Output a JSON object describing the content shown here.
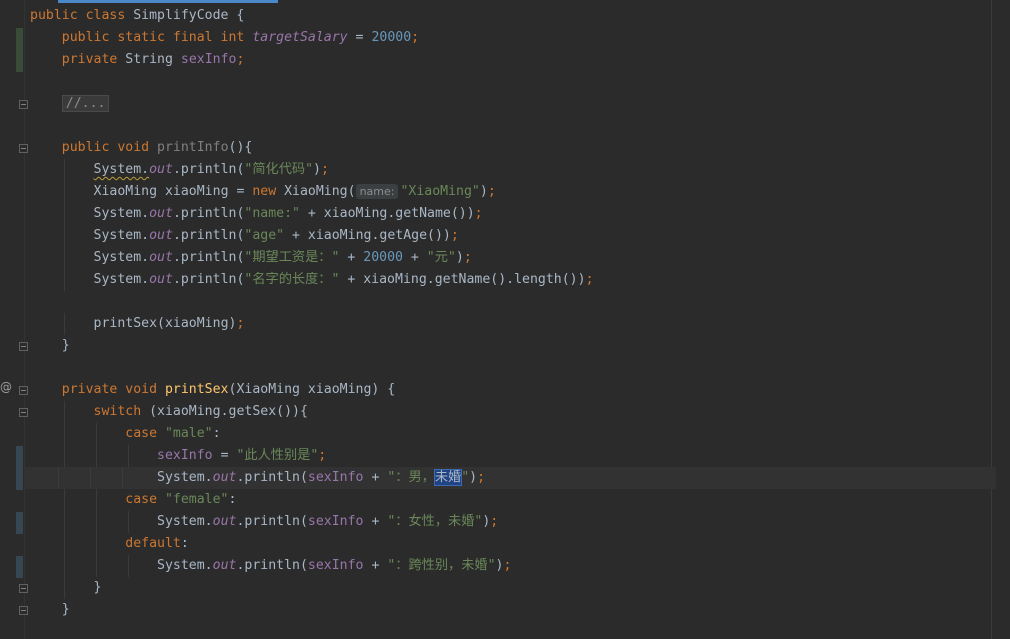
{
  "editor": {
    "lines": [
      [
        [
          "kw",
          "public class "
        ],
        [
          "plain",
          "SimplifyCode {"
        ]
      ],
      [
        [
          "kw",
          "public static final int "
        ],
        [
          "fld-i",
          "targetSalary"
        ],
        [
          "plain",
          " = "
        ],
        [
          "num",
          "20000"
        ],
        [
          "kw",
          ";"
        ]
      ],
      [
        [
          "kw",
          "private "
        ],
        [
          "plain",
          "String "
        ],
        [
          "fld",
          "sexInfo"
        ],
        [
          "kw",
          ";"
        ]
      ],
      [],
      [
        [
          "fold",
          "//..."
        ]
      ],
      [],
      [
        [
          "kw",
          "public void "
        ],
        [
          "muted",
          "printInfo"
        ],
        [
          "plain",
          "(){"
        ]
      ],
      [
        [
          "squig",
          "System."
        ],
        [
          "fld-i",
          "out"
        ],
        [
          "plain",
          ".println("
        ],
        [
          "str",
          "\"简化代码\""
        ],
        [
          "plain",
          ")"
        ],
        [
          "kw",
          ";"
        ]
      ],
      [
        [
          "plain",
          "XiaoMing xiaoMing = "
        ],
        [
          "kw",
          "new "
        ],
        [
          "plain",
          "XiaoMing("
        ],
        [
          "hint",
          "name:"
        ],
        [
          "str",
          "\"XiaoMing\""
        ],
        [
          "plain",
          ")"
        ],
        [
          "kw",
          ";"
        ]
      ],
      [
        [
          "plain",
          "System."
        ],
        [
          "fld-i",
          "out"
        ],
        [
          "plain",
          ".println("
        ],
        [
          "str",
          "\"name:\""
        ],
        [
          "plain",
          " + xiaoMing.getName())"
        ],
        [
          "kw",
          ";"
        ]
      ],
      [
        [
          "plain",
          "System."
        ],
        [
          "fld-i",
          "out"
        ],
        [
          "plain",
          ".println("
        ],
        [
          "str",
          "\"age\""
        ],
        [
          "plain",
          " + xiaoMing.getAge())"
        ],
        [
          "kw",
          ";"
        ]
      ],
      [
        [
          "plain",
          "System."
        ],
        [
          "fld-i",
          "out"
        ],
        [
          "plain",
          ".println("
        ],
        [
          "str",
          "\"期望工资是：\""
        ],
        [
          "plain",
          " + "
        ],
        [
          "num",
          "20000"
        ],
        [
          "plain",
          " + "
        ],
        [
          "str",
          "\"元\""
        ],
        [
          "plain",
          ")"
        ],
        [
          "kw",
          ";"
        ]
      ],
      [
        [
          "plain",
          "System."
        ],
        [
          "fld-i",
          "out"
        ],
        [
          "plain",
          ".println("
        ],
        [
          "str",
          "\"名字的长度：\""
        ],
        [
          "plain",
          " + xiaoMing.getName().length())"
        ],
        [
          "kw",
          ";"
        ]
      ],
      [],
      [
        [
          "plain",
          "printSex(xiaoMing)"
        ],
        [
          "kw",
          ";"
        ]
      ],
      [
        [
          "plain",
          "}"
        ]
      ],
      [],
      [
        [
          "kw",
          "private void "
        ],
        [
          "fn",
          "printSex"
        ],
        [
          "plain",
          "(XiaoMing xiaoMing) {"
        ]
      ],
      [
        [
          "kw",
          "switch "
        ],
        [
          "plain",
          "(xiaoMing.getSex()){"
        ]
      ],
      [
        [
          "kw",
          "case "
        ],
        [
          "str",
          "\"male\""
        ],
        [
          "plain",
          ":"
        ]
      ],
      [
        [
          "fld",
          "sexInfo"
        ],
        [
          "plain",
          " = "
        ],
        [
          "str",
          "\"此人性别是\""
        ],
        [
          "kw",
          ";"
        ]
      ],
      [
        [
          "plain",
          "System."
        ],
        [
          "fld-i",
          "out"
        ],
        [
          "plain",
          ".println("
        ],
        [
          "fld",
          "sexInfo"
        ],
        [
          "plain",
          " + "
        ],
        [
          "str",
          "\"：男，"
        ],
        [
          "sel",
          "未婚"
        ],
        [
          "str",
          "\""
        ],
        [
          "plain",
          ")"
        ],
        [
          "kw",
          ";"
        ]
      ],
      [
        [
          "kw",
          "case "
        ],
        [
          "str",
          "\"female\""
        ],
        [
          "plain",
          ":"
        ]
      ],
      [
        [
          "plain",
          "System."
        ],
        [
          "fld-i",
          "out"
        ],
        [
          "plain",
          ".println("
        ],
        [
          "fld",
          "sexInfo"
        ],
        [
          "plain",
          " + "
        ],
        [
          "str",
          "\"：女性，未婚\""
        ],
        [
          "plain",
          ")"
        ],
        [
          "kw",
          ";"
        ]
      ],
      [
        [
          "kw",
          "default"
        ],
        [
          "plain",
          ":"
        ]
      ],
      [
        [
          "plain",
          "System."
        ],
        [
          "fld-i",
          "out"
        ],
        [
          "plain",
          ".println("
        ],
        [
          "fld",
          "sexInfo"
        ],
        [
          "plain",
          " + "
        ],
        [
          "str",
          "\"：跨性别，未婚\""
        ],
        [
          "plain",
          ")"
        ],
        [
          "kw",
          ";"
        ]
      ],
      [
        [
          "plain",
          "}"
        ]
      ],
      [
        [
          "plain",
          "}"
        ]
      ]
    ]
  },
  "gutter": {
    "override_icon": "@",
    "intention_icon": "lightbulb-icon"
  }
}
